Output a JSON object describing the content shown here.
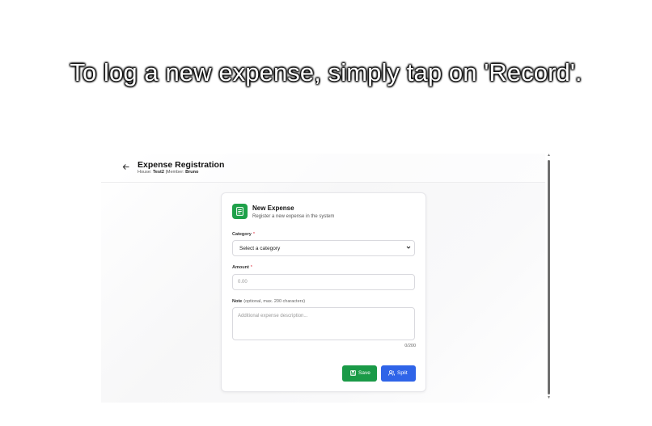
{
  "caption": "To log a new expense, simply tap on 'Record'.",
  "header": {
    "back_icon": "arrow-left-icon",
    "title": "Expense Registration",
    "house_label": "House:",
    "house_value": "Test2",
    "member_label": "|Member:",
    "member_value": "Bruno"
  },
  "form": {
    "icon": "document-icon",
    "accent_color": "#1fa14a",
    "title": "New Expense",
    "subtitle": "Register a new expense in the system",
    "category": {
      "label": "Category",
      "required_mark": "*",
      "selected": "Select a category",
      "caret": "⌄"
    },
    "amount": {
      "label": "Amount",
      "required_mark": "*",
      "placeholder": "0.00"
    },
    "note": {
      "label": "Note",
      "hint": "(optional, max. 200 characters)",
      "placeholder": "Additional expense description...",
      "counter": "0/200"
    },
    "buttons": {
      "save_label": "Save",
      "save_color": "#1a9a47",
      "split_label": "Split",
      "split_color": "#2f64e8"
    }
  },
  "scrollbar": {
    "up_arrow": "▲",
    "down_arrow": "▼"
  }
}
